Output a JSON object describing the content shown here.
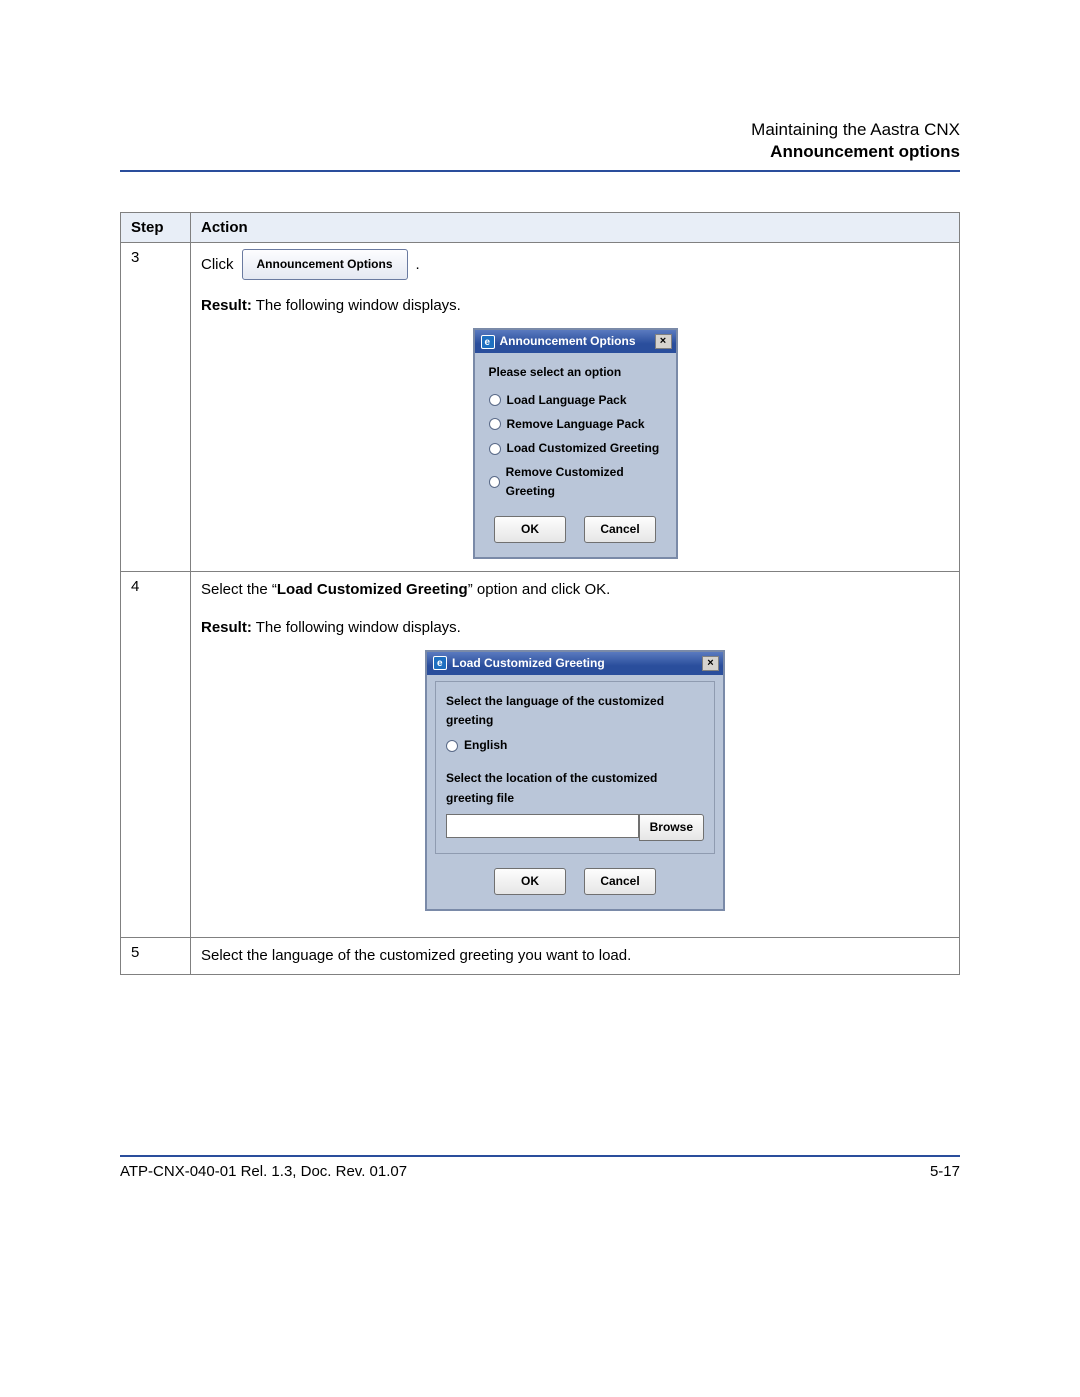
{
  "header": {
    "chapter": "Maintaining the Aastra CNX",
    "section": "Announcement options"
  },
  "table": {
    "headers": {
      "step": "Step",
      "action": "Action"
    },
    "rows": [
      {
        "step": "3",
        "click_word": "Click",
        "button_label": "Announcement Options",
        "dot": ".",
        "result_label": "Result:",
        "result_text": " The following window displays.",
        "dialog1": {
          "title": "Announcement Options",
          "prompt": "Please select an option",
          "options": [
            "Load Language Pack",
            "Remove Language Pack",
            "Load Customized Greeting",
            "Remove Customized Greeting"
          ],
          "ok": "OK",
          "cancel": "Cancel"
        }
      },
      {
        "step": "4",
        "pre": "Select the “",
        "bold": "Load Customized Greeting",
        "post": "” option and click OK.",
        "result_label": "Result:",
        "result_text": " The following window displays.",
        "dialog2": {
          "title": "Load Customized Greeting",
          "lang_label": "Select the language of the customized greeting",
          "lang_option": "English",
          "file_label": "Select the location of the customized greeting file",
          "browse": "Browse",
          "ok": "OK",
          "cancel": "Cancel"
        }
      },
      {
        "step": "5",
        "text": "Select the language of the customized greeting you want to load."
      }
    ]
  },
  "footer": {
    "left": "ATP-CNX-040-01 Rel. 1.3, Doc. Rev. 01.07",
    "right": "5-17"
  }
}
